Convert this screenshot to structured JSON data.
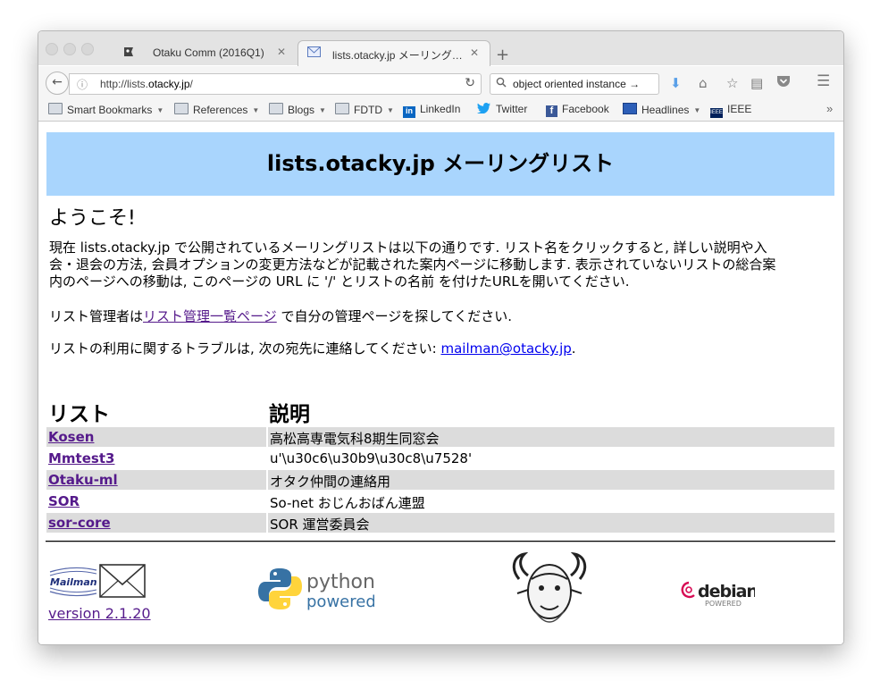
{
  "browser": {
    "tabs": [
      {
        "label": "Otaku Comm (2016Q1)",
        "active": false
      },
      {
        "label": "lists.otacky.jp メーリング…",
        "active": true
      }
    ],
    "url": "http://lists.otacky.jp/",
    "url_prefix": "http://lists.",
    "url_domain": "otacky.jp",
    "url_suffix": "/",
    "search_text": "object oriented instance",
    "bookmarks": [
      {
        "label": "Smart Bookmarks",
        "icon": "folder-icon",
        "dropdown": true
      },
      {
        "label": "References",
        "icon": "folder-icon",
        "dropdown": true
      },
      {
        "label": "Blogs",
        "icon": "folder-icon",
        "dropdown": true
      },
      {
        "label": "FDTD",
        "icon": "folder-icon",
        "dropdown": true
      },
      {
        "label": "LinkedIn",
        "icon": "linkedin-icon",
        "dropdown": false
      },
      {
        "label": "Twitter",
        "icon": "twitter-icon",
        "dropdown": false
      },
      {
        "label": "Facebook",
        "icon": "facebook-icon",
        "dropdown": false
      },
      {
        "label": "Headlines",
        "icon": "rss-icon",
        "dropdown": true
      },
      {
        "label": "IEEE",
        "icon": "ieee-icon",
        "dropdown": false
      }
    ]
  },
  "page": {
    "header_title": "lists.otacky.jp メーリングリスト",
    "welcome": "ようこそ!",
    "intro_line1": "現在 lists.otacky.jp で公開されているメーリングリストは以下の通りです. リスト名をクリックすると, 詳しい説明や入",
    "intro_line2": "会・退会の方法, 会員オプションの変更方法などが記載された案内ページに移動します. 表示されていないリストの総合案",
    "intro_line3": "内のページへの移動は, このページの URL に '/' とリストの名前 を付けたURLを開いてください.",
    "admin_prefix": "リスト管理者は",
    "admin_link": "リスト管理一覧ページ",
    "admin_suffix": " で自分の管理ページを探してください.",
    "trouble_prefix": "リストの利用に関するトラブルは, 次の宛先に連絡してください: ",
    "trouble_email": "mailman@otacky.jp",
    "trouble_suffix": ".",
    "table_header_list": "リスト",
    "table_header_desc": "説明",
    "lists": [
      {
        "name": "Kosen",
        "description": "高松高専電気科8期生同窓会"
      },
      {
        "name": "Mmtest3",
        "description": "u'\\u30c6\\u30b9\\u30c8\\u7528'"
      },
      {
        "name": "Otaku-ml",
        "description": "オタク仲間の連絡用"
      },
      {
        "name": "SOR",
        "description": "So-net おじんおばん連盟"
      },
      {
        "name": "sor-core",
        "description": "SOR 運営委員会"
      }
    ],
    "footer": {
      "mailman_logo_text": "Mailman",
      "version_link": "version 2.1.20",
      "python_word1": "python",
      "python_word2": "powered",
      "debian_text": "debian",
      "debian_sub": "POWERED"
    }
  }
}
